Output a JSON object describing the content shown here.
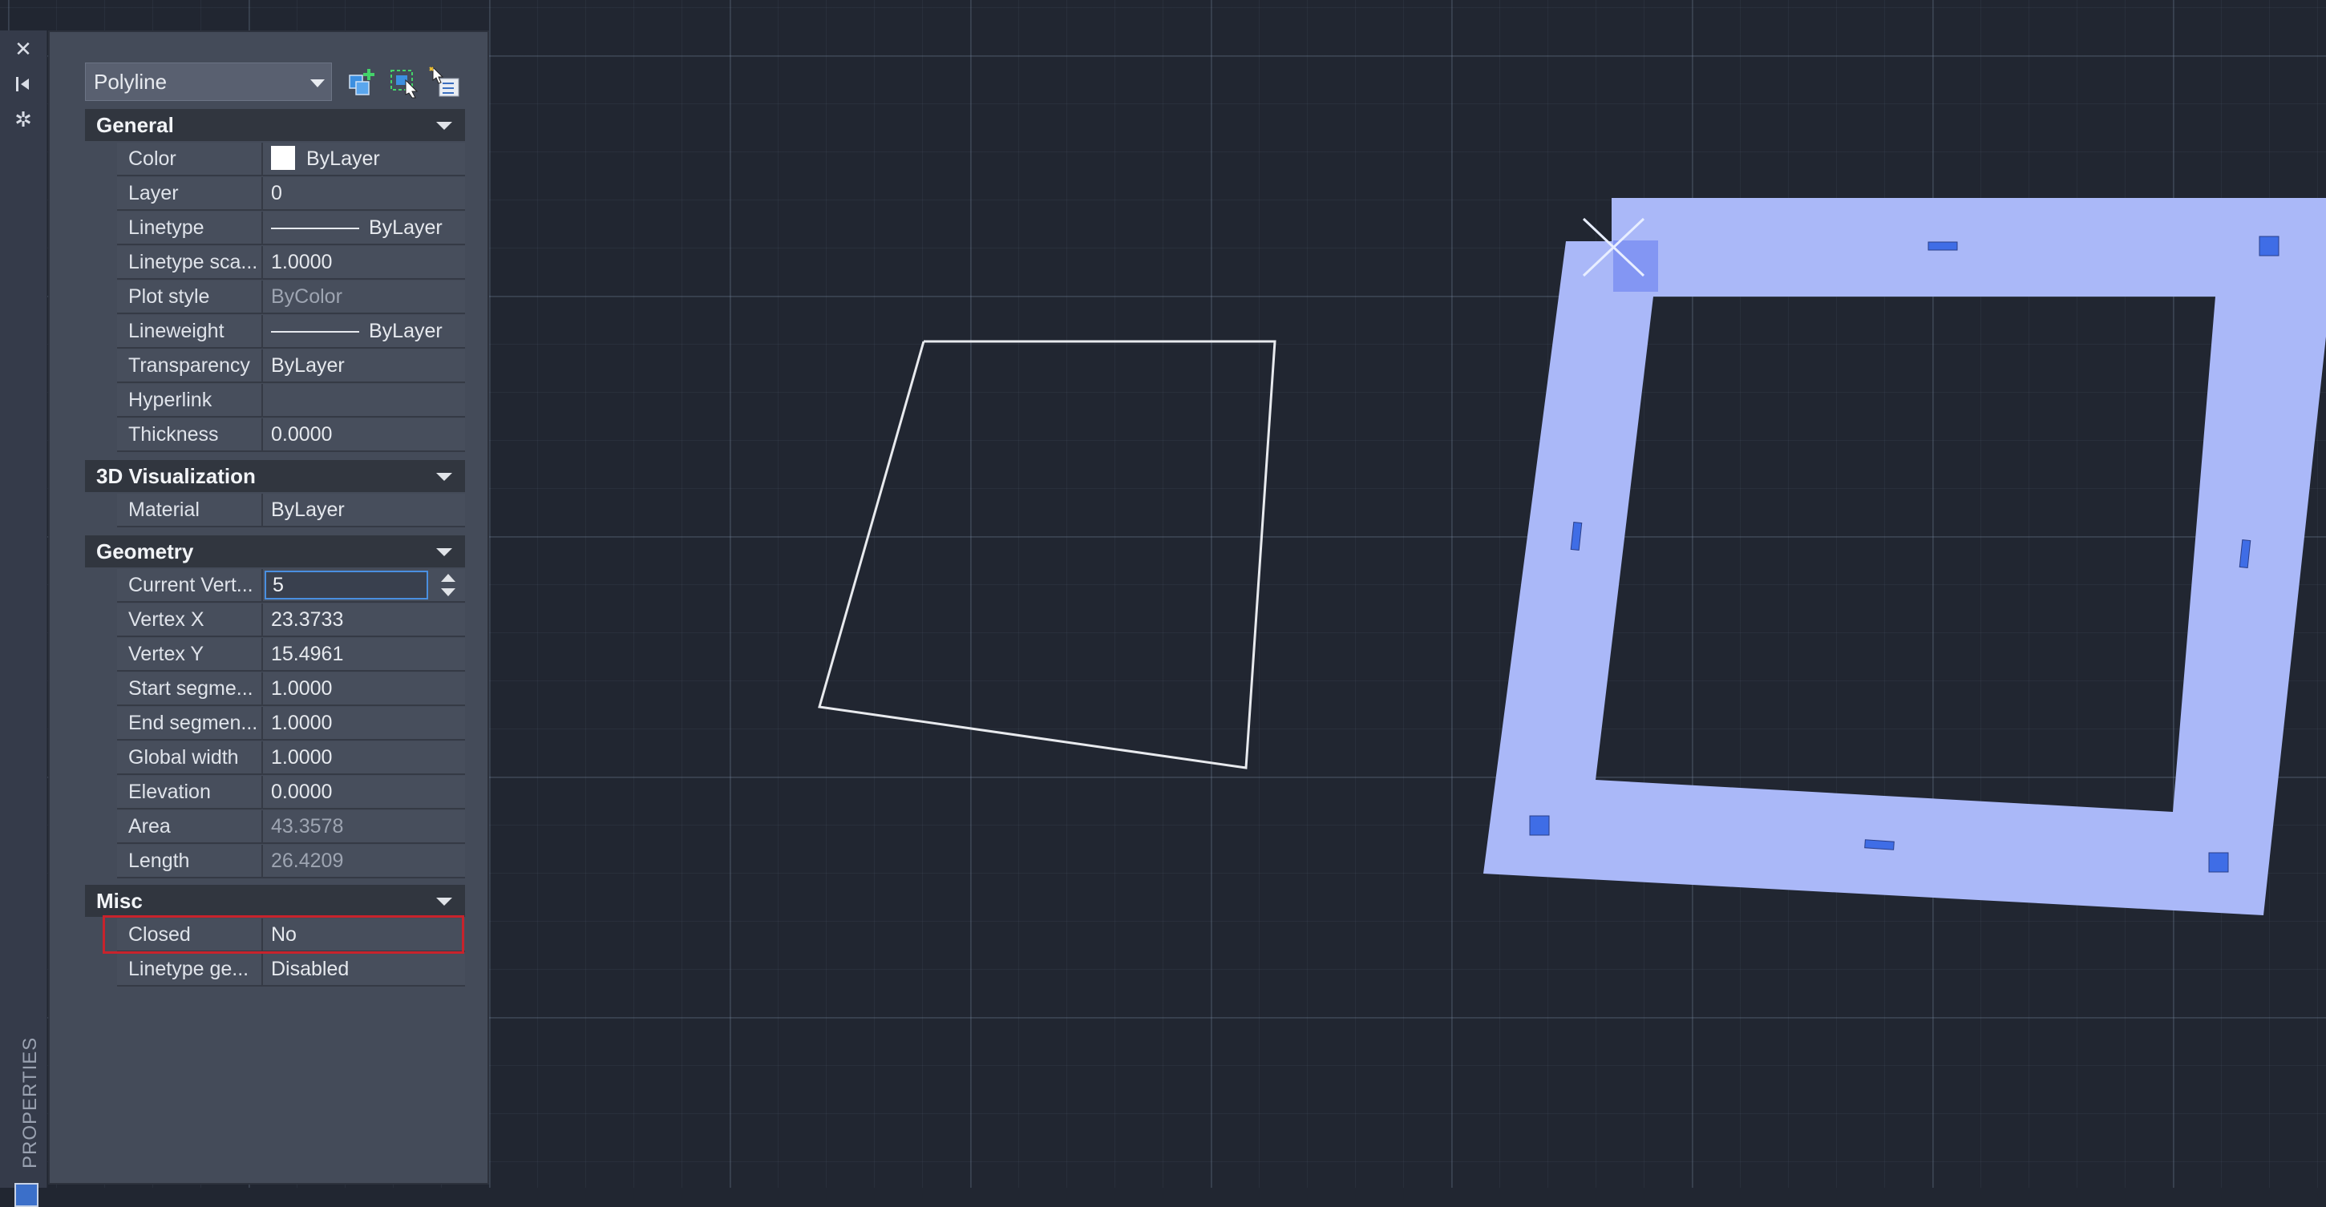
{
  "palette": {
    "title": "PROPERTIES",
    "close_icon": "close-icon",
    "autohide_icon": "autohide-icon",
    "settings_icon": "settings-icon"
  },
  "selector": {
    "value": "Polyline"
  },
  "toolbar": {
    "buttons": [
      "toggle-pickadd-icon",
      "select-objects-icon",
      "quick-select-icon"
    ]
  },
  "sections": {
    "general": {
      "title": "General",
      "rows": {
        "color": {
          "key": "Color",
          "value": "ByLayer",
          "swatch": "#ffffff"
        },
        "layer": {
          "key": "Layer",
          "value": "0"
        },
        "linetype": {
          "key": "Linetype",
          "value": "ByLayer"
        },
        "linetype_scale": {
          "key": "Linetype sca...",
          "value": "1.0000"
        },
        "plot_style": {
          "key": "Plot style",
          "value": "ByColor"
        },
        "lineweight": {
          "key": "Lineweight",
          "value": "ByLayer"
        },
        "transparency": {
          "key": "Transparency",
          "value": "ByLayer"
        },
        "hyperlink": {
          "key": "Hyperlink",
          "value": ""
        },
        "thickness": {
          "key": "Thickness",
          "value": "0.0000"
        }
      }
    },
    "visualization": {
      "title": "3D Visualization",
      "rows": {
        "material": {
          "key": "Material",
          "value": "ByLayer"
        }
      }
    },
    "geometry": {
      "title": "Geometry",
      "rows": {
        "current_vertex": {
          "key": "Current  Vert...",
          "value": "5"
        },
        "vertex_x": {
          "key": "Vertex X",
          "value": "23.3733"
        },
        "vertex_y": {
          "key": "Vertex Y",
          "value": "15.4961"
        },
        "start_segment": {
          "key": "Start  segme...",
          "value": "1.0000"
        },
        "end_segment": {
          "key": "End  segmen...",
          "value": "1.0000"
        },
        "global_width": {
          "key": "Global width",
          "value": "1.0000"
        },
        "elevation": {
          "key": "Elevation",
          "value": "0.0000"
        },
        "area": {
          "key": "Area",
          "value": "43.3578"
        },
        "length": {
          "key": "Length",
          "value": "26.4209"
        }
      }
    },
    "misc": {
      "title": "Misc",
      "rows": {
        "closed": {
          "key": "Closed",
          "value": "No"
        },
        "linetype_gen": {
          "key": "Linetype ge...",
          "value": "Disabled"
        }
      }
    }
  },
  "colors": {
    "background": "#212631",
    "panel": "#444b59",
    "selection_fill": "#aab8f8",
    "grip": "#3f6de6",
    "highlight": "#c8232c",
    "polyline": "#e8eaee"
  }
}
